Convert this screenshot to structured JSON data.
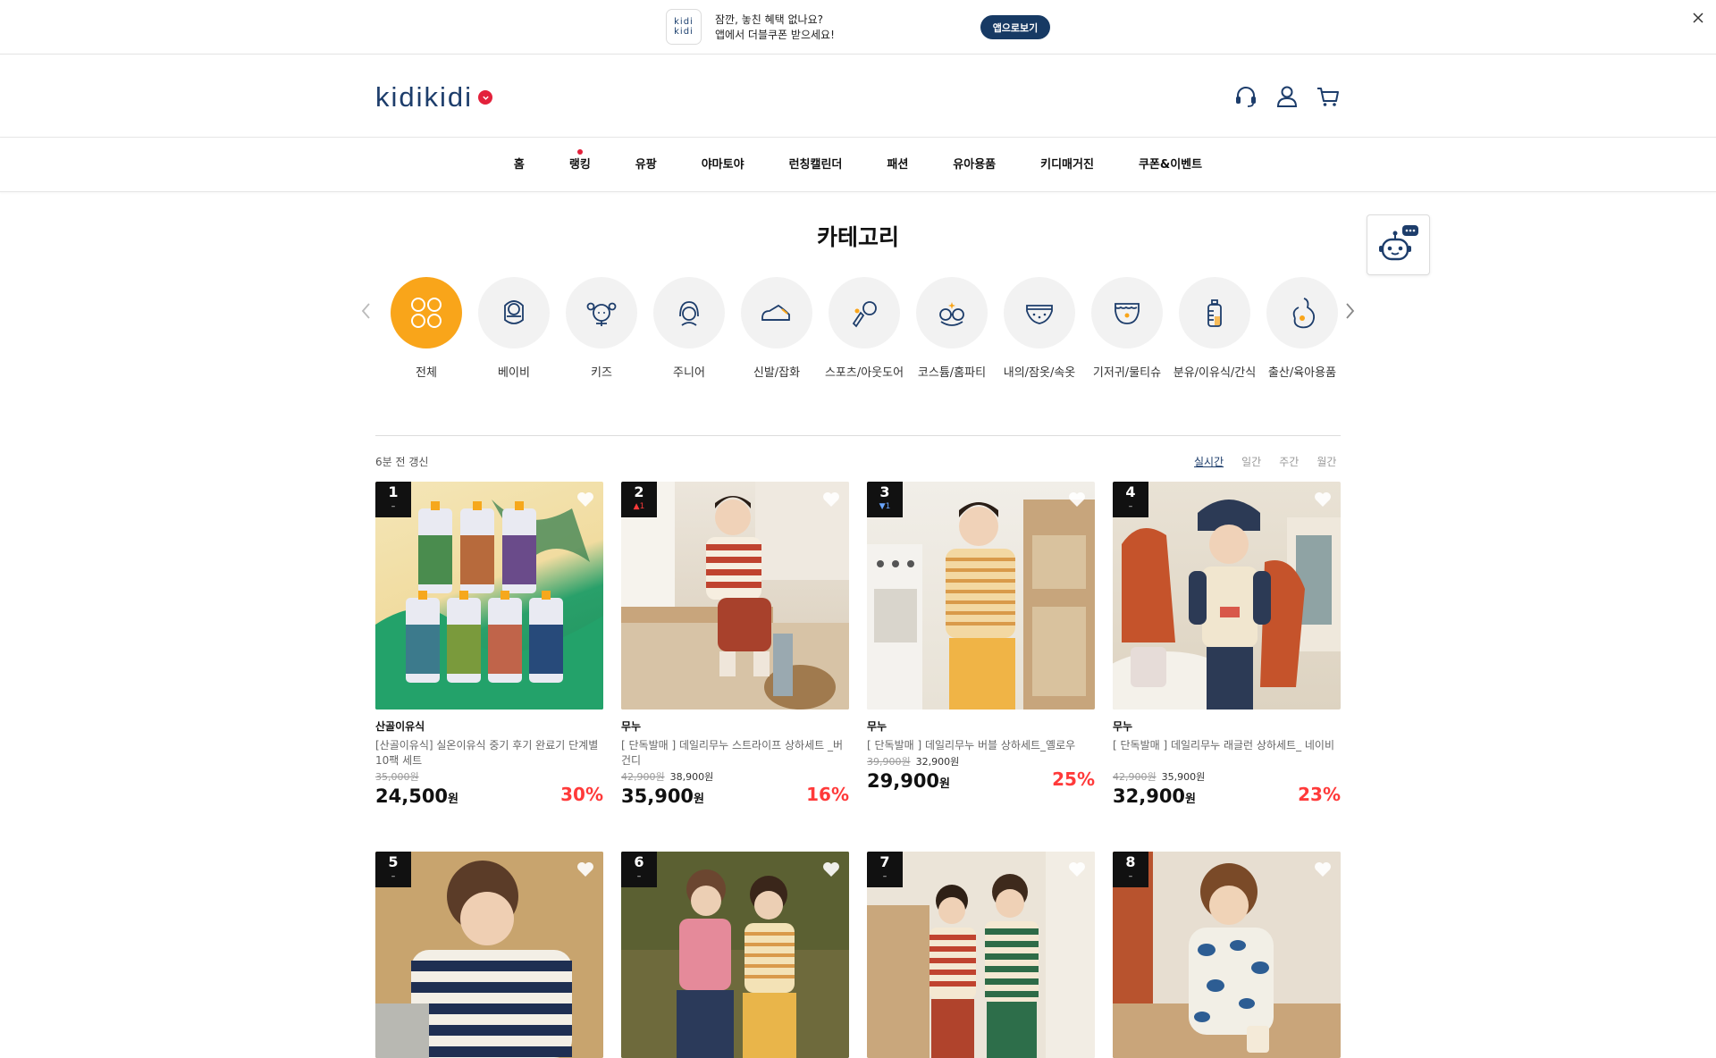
{
  "banner": {
    "icon_line1": "kidi",
    "icon_line2": "kidi",
    "line1": "잠깐, 놓친 혜택 없나요?",
    "line2": "앱에서 더블쿠폰 받으세요!",
    "app_button": "앱으로보기"
  },
  "header": {
    "logo": "kidikidi"
  },
  "nav": {
    "items": [
      "홈",
      "랭킹",
      "유팡",
      "야마토야",
      "런칭캘린더",
      "패션",
      "유아용품",
      "키디매거진",
      "쿠폰&이벤트"
    ]
  },
  "category": {
    "title": "카테고리",
    "items": [
      {
        "label": "전체",
        "icon": "grid-icon"
      },
      {
        "label": "베이비",
        "icon": "baby-icon"
      },
      {
        "label": "키즈",
        "icon": "kids-icon"
      },
      {
        "label": "주니어",
        "icon": "junior-icon"
      },
      {
        "label": "신발/잡화",
        "icon": "shoe-icon"
      },
      {
        "label": "스포츠/아웃도어",
        "icon": "sports-icon"
      },
      {
        "label": "코스튬/홈파티",
        "icon": "costume-icon"
      },
      {
        "label": "내의/잠옷/속옷",
        "icon": "underwear-icon"
      },
      {
        "label": "기저귀/물티슈",
        "icon": "diaper-icon"
      },
      {
        "label": "분유/이유식/간식",
        "icon": "bottle-icon"
      },
      {
        "label": "출산/육아용품",
        "icon": "maternity-icon"
      }
    ]
  },
  "ranking": {
    "updated": "6분 전 갱신",
    "tabs": [
      "실시간",
      "일간",
      "주간",
      "월간"
    ],
    "products": [
      {
        "rank": "1",
        "change": "–",
        "brand": "산골이유식",
        "name": "[산골이유식] 실온이유식 중기 후기 완료기 단계별 10팩 세트",
        "orig": "35,000원",
        "sale_small": "",
        "price": "24,500",
        "won": "원",
        "discount": "30%"
      },
      {
        "rank": "2",
        "change": "▲1",
        "brand": "무누",
        "name": "[ 단독발매 ] 데일리무누 스트라이프 상하세트 _버건디",
        "orig": "42,900원",
        "sale_small": "38,900원",
        "price": "35,900",
        "won": "원",
        "discount": "16%"
      },
      {
        "rank": "3",
        "change": "▼1",
        "brand": "무누",
        "name": "[ 단독발매 ] 데일리무누 버블 상하세트_옐로우",
        "orig": "39,900원",
        "sale_small": "32,900원",
        "price": "29,900",
        "won": "원",
        "discount": "25%"
      },
      {
        "rank": "4",
        "change": "–",
        "brand": "무누",
        "name": "[ 단독발매 ] 데일리무누 래글런 상하세트_ 네이비",
        "orig": "42,900원",
        "sale_small": "35,900원",
        "price": "32,900",
        "won": "원",
        "discount": "23%"
      },
      {
        "rank": "5",
        "change": "–"
      },
      {
        "rank": "6",
        "change": "–"
      },
      {
        "rank": "7",
        "change": "–"
      },
      {
        "rank": "8",
        "change": "–"
      }
    ]
  },
  "colors": {
    "navy": "#1d3d6b",
    "accent_orange": "#f9a51a",
    "discount_red": "#ff3a3a"
  }
}
